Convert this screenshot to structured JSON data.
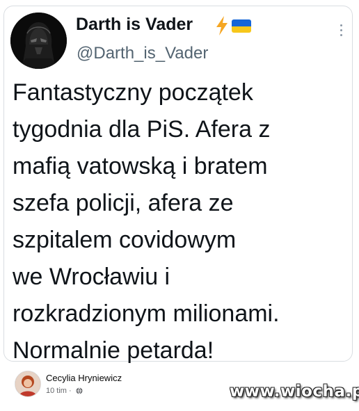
{
  "tweet": {
    "display_name": "Darth is Vader",
    "handle": "@Darth_is_Vader",
    "name_emoji_icons": [
      "lightning-bolt-icon",
      "ukraine-flag-icon"
    ],
    "text": "Fantastyczny początek\ntygodnia dla PiS. Afera z\nmafią vatowską i bratem\nszefa policji, afera ze\nszpitalem covidowym\nwe Wrocławiu i\nrozkradzionym milionami.\nNormalnie petarda!"
  },
  "share": {
    "author": "Cecylia Hryniewicz",
    "time": "10 tim",
    "separator": "·",
    "audience_icon": "globe-icon"
  },
  "watermark": "www.wiocha.pl",
  "colors": {
    "text": "#0f1419",
    "muted": "#536471",
    "flag_blue": "#1565d8",
    "flag_yellow": "#f7c71b",
    "bolt": "#f5a623"
  }
}
